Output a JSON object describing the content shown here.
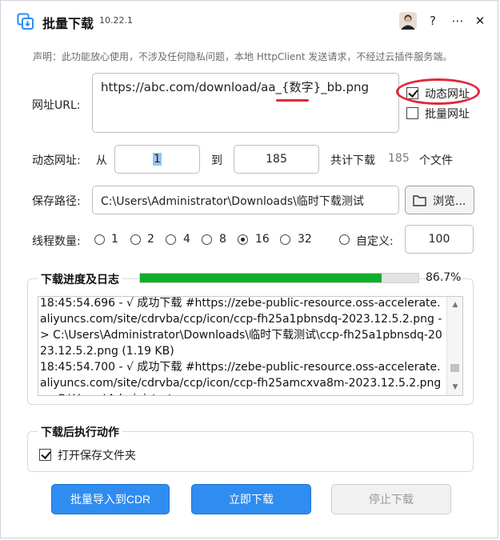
{
  "window": {
    "title": "批量下载",
    "version": "10.22.1",
    "help": "?",
    "menu": "⋯",
    "close": "✕"
  },
  "notice": "声明：此功能放心使用，不涉及任何隐私问题，本地 HttpClient 发送请求，不经过云插件服务端。",
  "url": {
    "label": "网址URL:",
    "value": "https://abc.com/download/aa_{数字}_bb.png",
    "dynamic_label": "动态网址",
    "dynamic_checked": true,
    "batch_label": "批量网址",
    "batch_checked": false
  },
  "dynamic": {
    "label": "动态网址:",
    "from_label": "从",
    "from_value": "1",
    "to_label": "到",
    "to_value": "185",
    "total_label": "共计下载",
    "total_value": "185",
    "unit_label": "个文件"
  },
  "save": {
    "label": "保存路径:",
    "path": "C:\\Users\\Administrator\\Downloads\\临时下载测试",
    "browse_label": "浏览..."
  },
  "threads": {
    "label": "线程数量:",
    "options": [
      "1",
      "2",
      "4",
      "8",
      "16",
      "32"
    ],
    "selected": "16",
    "custom_label": "自定义:",
    "custom_value": "100"
  },
  "progress": {
    "title": "下载进度及日志",
    "percent_text": "86.7%",
    "fraction": 0.867,
    "log": "18:45:54.696 - √ 成功下载 #https://zebe-public-resource.oss-accelerate.aliyuncs.com/site/cdrvba/ccp/icon/ccp-fh25a1pbnsdq-2023.12.5.2.png -> C:\\Users\\Administrator\\Downloads\\临时下载测试\\ccp-fh25a1pbnsdq-2023.12.5.2.png (1.19 KB)\n18:45:54.700 - √ 成功下载 #https://zebe-public-resource.oss-accelerate.aliyuncs.com/site/cdrvba/ccp/icon/ccp-fh25amcxva8m-2023.12.5.2.png -> C:\\Users\\Administrator"
  },
  "after": {
    "title": "下载后执行动作",
    "open_folder_label": "打开保存文件夹",
    "open_folder_checked": true
  },
  "buttons": {
    "import_label": "批量导入到CDR",
    "download_label": "立即下载",
    "stop_label": "停止下载"
  },
  "colors": {
    "accent": "#2f8cf0",
    "progress": "#0fae2a",
    "annotation": "#e0283a"
  }
}
